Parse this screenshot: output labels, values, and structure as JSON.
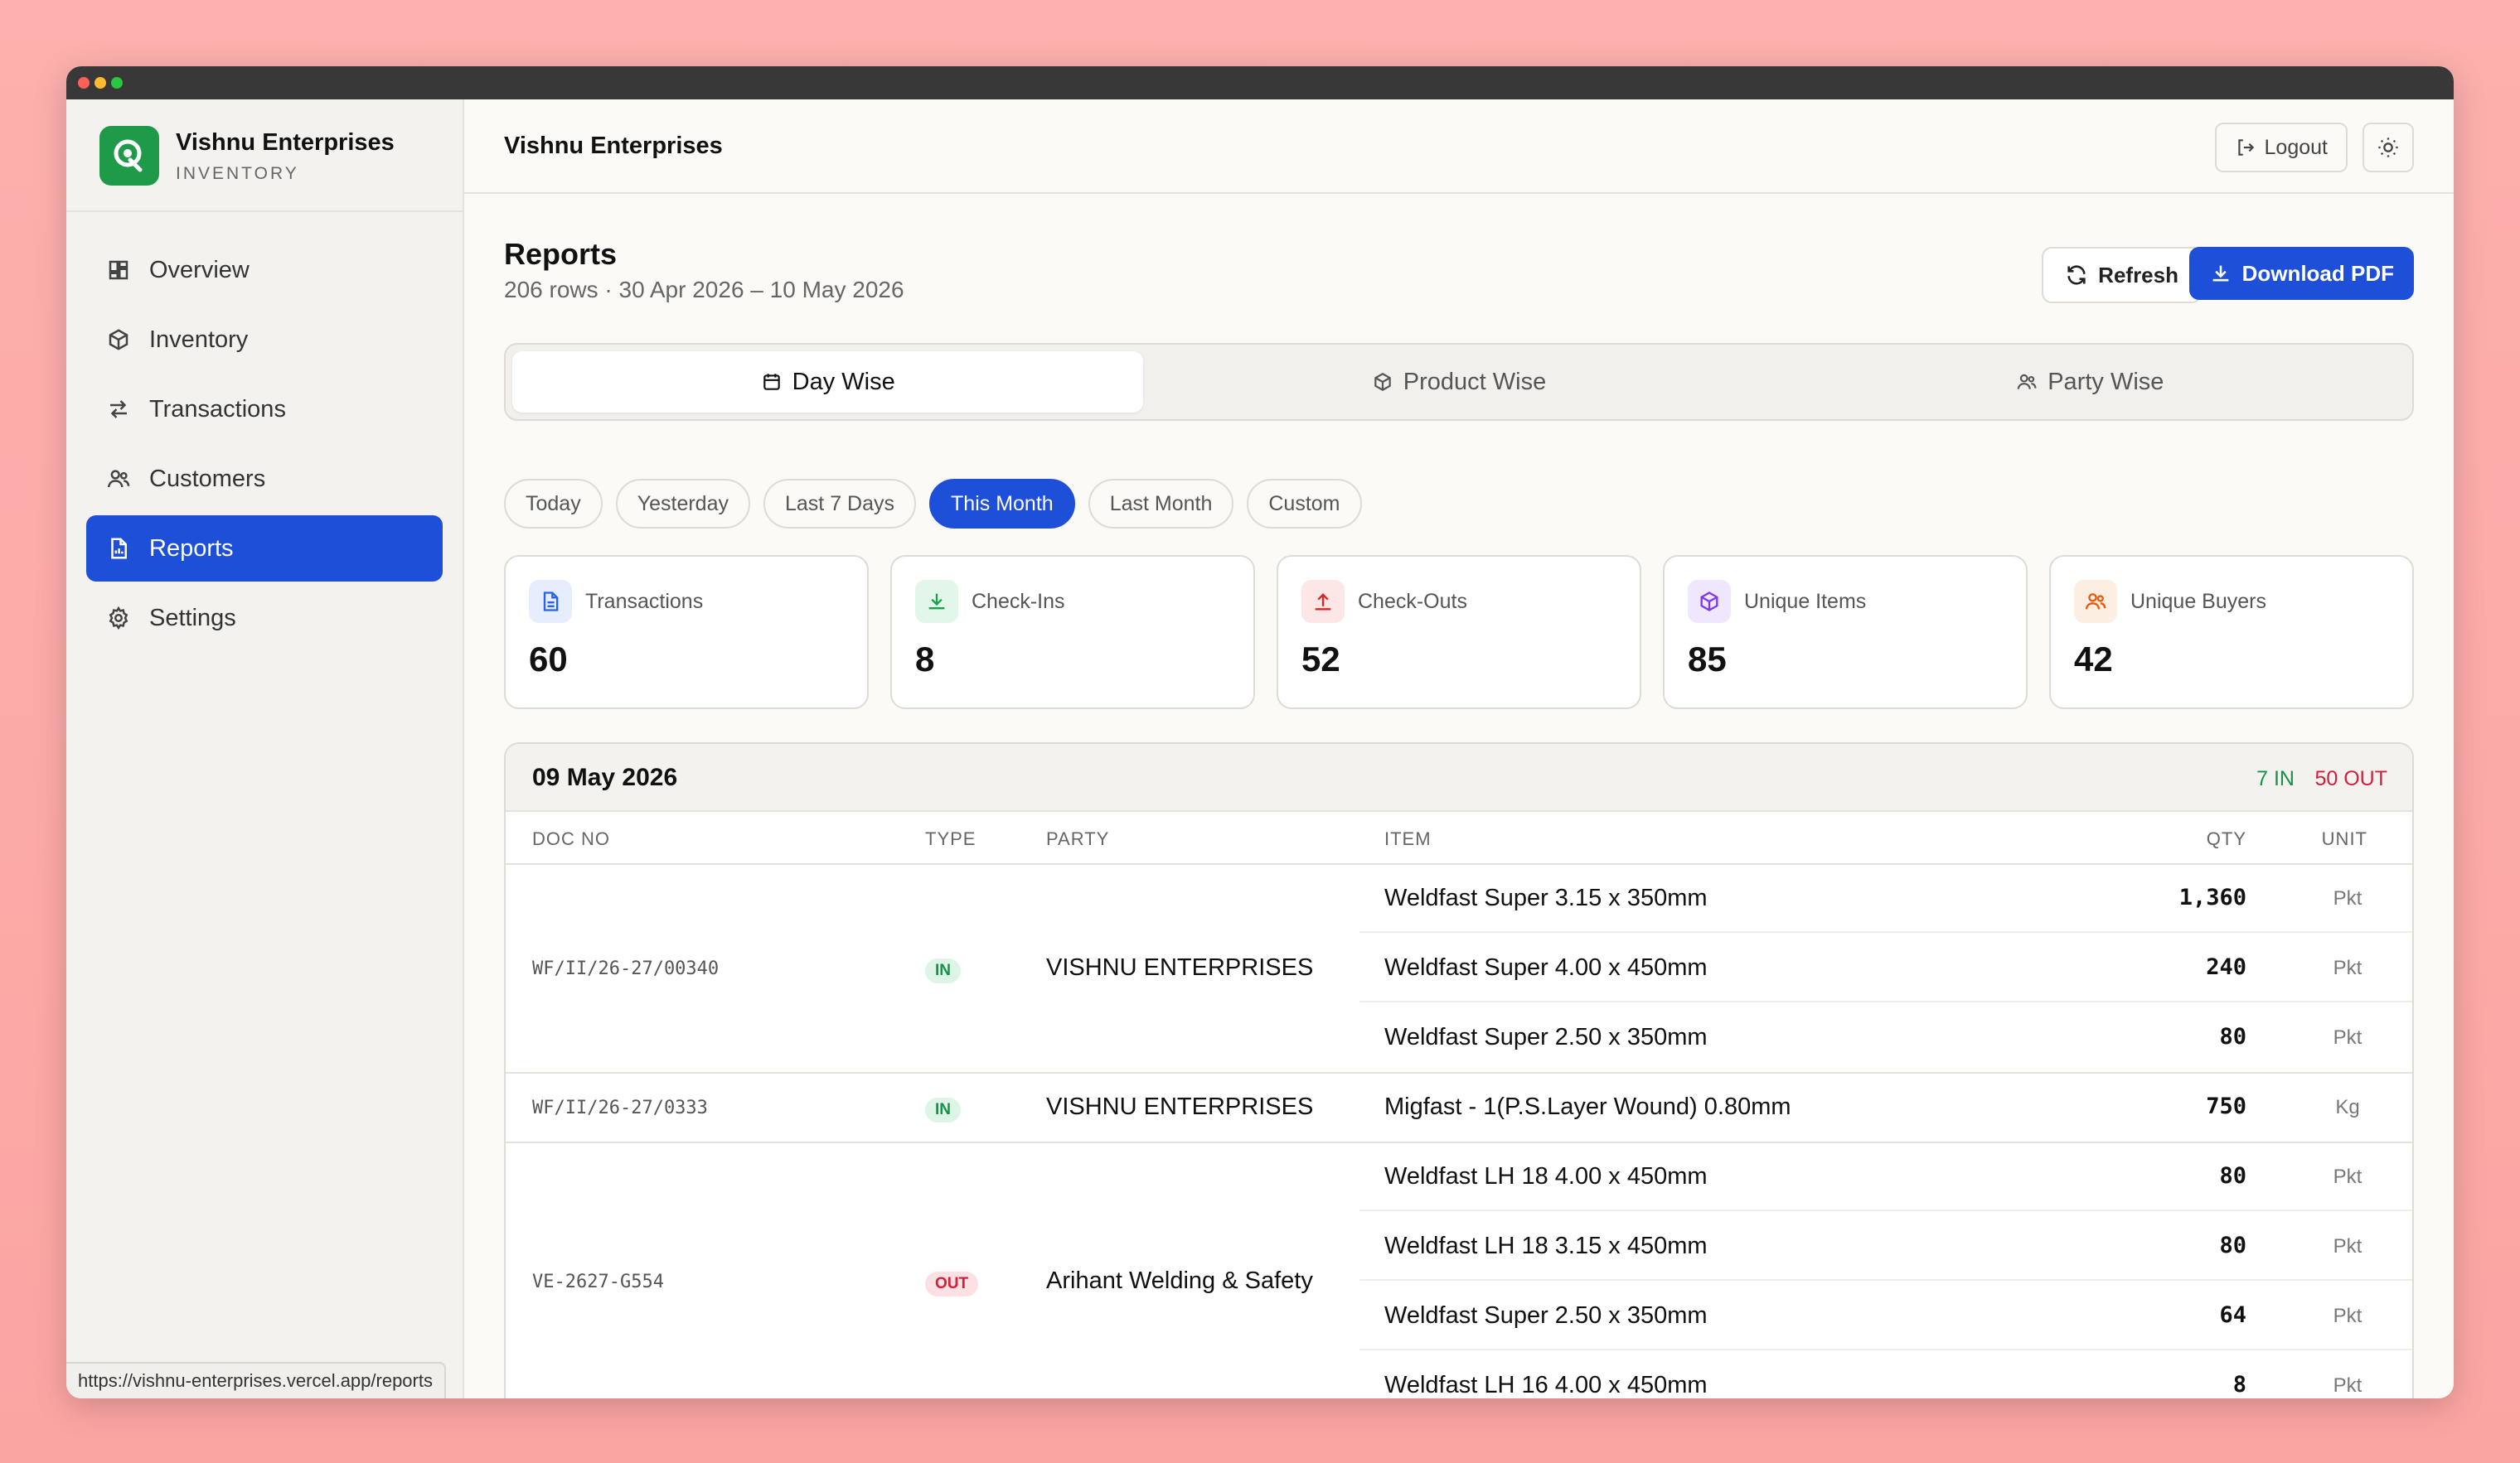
{
  "brand": {
    "name": "Vishnu Enterprises",
    "subtitle": "INVENTORY"
  },
  "nav": [
    {
      "label": "Overview",
      "icon": "grid-icon"
    },
    {
      "label": "Inventory",
      "icon": "box-icon"
    },
    {
      "label": "Transactions",
      "icon": "arrows-icon"
    },
    {
      "label": "Customers",
      "icon": "users-icon"
    },
    {
      "label": "Reports",
      "icon": "file-chart-icon",
      "active": true
    },
    {
      "label": "Settings",
      "icon": "gear-icon"
    }
  ],
  "status_url": "https://vishnu-enterprises.vercel.app/reports",
  "topbar": {
    "title": "Vishnu Enterprises",
    "logout_label": "Logout"
  },
  "page": {
    "title": "Reports",
    "subtitle": "206 rows · 30 Apr 2026 – 10 May 2026",
    "refresh_label": "Refresh",
    "download_label": "Download PDF"
  },
  "tabs": [
    {
      "label": "Day Wise",
      "active": true
    },
    {
      "label": "Product Wise"
    },
    {
      "label": "Party Wise"
    }
  ],
  "ranges": [
    "Today",
    "Yesterday",
    "Last 7 Days",
    "This Month",
    "Last Month",
    "Custom"
  ],
  "active_range": "This Month",
  "stats": [
    {
      "label": "Transactions",
      "value": "60",
      "icon": "document-icon",
      "color": "#2563eb"
    },
    {
      "label": "Check-Ins",
      "value": "8",
      "icon": "download-icon",
      "color": "#16a34a"
    },
    {
      "label": "Check-Outs",
      "value": "52",
      "icon": "upload-icon",
      "color": "#dc2626"
    },
    {
      "label": "Unique Items",
      "value": "85",
      "icon": "cube-icon",
      "color": "#7c3aed"
    },
    {
      "label": "Unique Buyers",
      "value": "42",
      "icon": "users-icon",
      "color": "#ea580c"
    }
  ],
  "group": {
    "date": "09 May 2026",
    "in_label": "7 IN",
    "out_label": "50 OUT",
    "columns": {
      "doc_no": "DOC NO",
      "type": "TYPE",
      "party": "PARTY",
      "item": "ITEM",
      "qty": "QTY",
      "unit": "UNIT"
    },
    "docs": [
      {
        "doc_no": "WF/II/26-27/00340",
        "type": "IN",
        "party": "VISHNU ENTERPRISES",
        "lines": [
          {
            "item": "Weldfast Super 3.15 x 350mm",
            "qty": "1,360",
            "unit": "Pkt"
          },
          {
            "item": "Weldfast Super 4.00 x 450mm",
            "qty": "240",
            "unit": "Pkt"
          },
          {
            "item": "Weldfast Super 2.50 x 350mm",
            "qty": "80",
            "unit": "Pkt"
          }
        ]
      },
      {
        "doc_no": "WF/II/26-27/0333",
        "type": "IN",
        "party": "VISHNU ENTERPRISES",
        "lines": [
          {
            "item": "Migfast - 1(P.S.Layer Wound) 0.80mm",
            "qty": "750",
            "unit": "Kg"
          }
        ]
      },
      {
        "doc_no": "VE-2627-G554",
        "type": "OUT",
        "party": "Arihant Welding & Safety",
        "lines": [
          {
            "item": "Weldfast LH 18 4.00 x 450mm",
            "qty": "80",
            "unit": "Pkt"
          },
          {
            "item": "Weldfast LH 18 3.15 x 450mm",
            "qty": "80",
            "unit": "Pkt"
          },
          {
            "item": "Weldfast Super 2.50 x 350mm",
            "qty": "64",
            "unit": "Pkt"
          },
          {
            "item": "Weldfast LH 16 4.00 x 450mm",
            "qty": "8",
            "unit": "Pkt"
          }
        ]
      }
    ]
  }
}
